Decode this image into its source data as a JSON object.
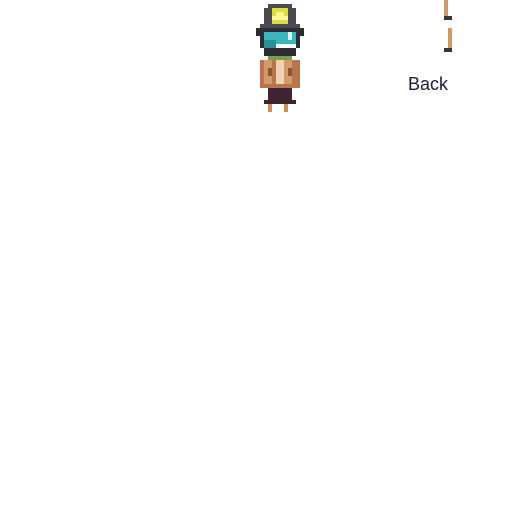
{
  "ui": {
    "back_label": "Back"
  },
  "scene": {
    "background": "#ffffff",
    "character": "player-avatar",
    "character_palette": {
      "helmet": "#4a4b52",
      "helmet_shadow": "#2d2e35",
      "badge": "#d9df3c",
      "badge_light": "#f6f89a",
      "visor": "#39b6bb",
      "visor_shadow": "#2c8f94",
      "face": "#2b2d33",
      "collar": "#7a9c53",
      "vest": "#b8754c",
      "vest_light": "#d59a6c",
      "shirt": "#f0d3b4",
      "legs": "#3f2434",
      "feet": "#c98f57"
    },
    "prop_palette": {
      "pole": "#c99a67",
      "dark": "#3a3636"
    }
  }
}
